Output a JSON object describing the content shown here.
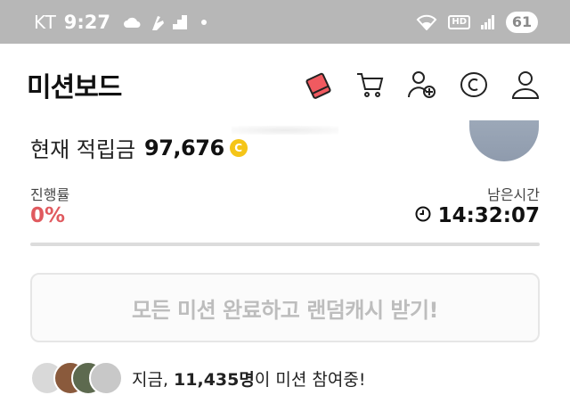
{
  "statusbar": {
    "carrier": "KT",
    "time": "9:27",
    "battery": "61",
    "hd_label": "HD"
  },
  "header": {
    "title": "미션보드"
  },
  "points": {
    "label": "현재 적립금",
    "value": "97,676",
    "coin_symbol": "C"
  },
  "progress": {
    "label": "진행률",
    "value": "0%",
    "fraction": 0
  },
  "remaining": {
    "label": "남은시간",
    "value": "14:32:07"
  },
  "mission_button": {
    "label": "모든 미션 완료하고 랜덤캐시 받기!"
  },
  "participants": {
    "prefix": "지금,",
    "count": "11,435명",
    "suffix": "이 미션 참여중!"
  },
  "colors": {
    "accent": "#e05a5f",
    "statusbar": "#b7b7b7",
    "coin": "#f5c518"
  },
  "icons": [
    "cloud-icon",
    "hand-icon",
    "signal-step-icon",
    "wifi-icon",
    "cell-signal-icon",
    "mission-card-icon",
    "cart-icon",
    "add-friend-icon",
    "coin-c-icon",
    "profile-icon",
    "clock-icon"
  ]
}
